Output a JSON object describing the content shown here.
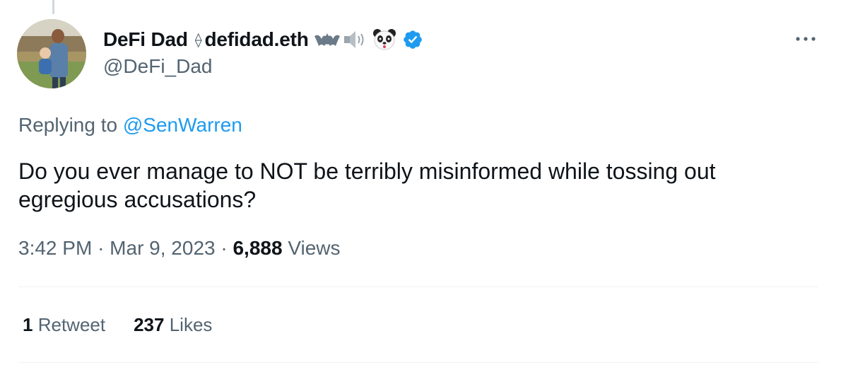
{
  "tweet": {
    "author": {
      "display_name": "DeFi Dad",
      "eth_symbol": "⟠",
      "ens_name": "defidad.eth",
      "emojis": [
        "bat-emoji",
        "speaker-emoji",
        "panda-emoji"
      ],
      "verified": true,
      "handle": "@DeFi_Dad",
      "avatar": "avatar-photo"
    },
    "replying_prefix": "Replying to",
    "replying_to": "@SenWarren",
    "text": "Do you ever manage to NOT be terribly misinformed while tossing out egregious accusations?",
    "time": "3:42 PM",
    "separator": "·",
    "date": "Mar 9, 2023",
    "views_count": "6,888",
    "views_label": "Views",
    "stats": {
      "retweets_count": "1",
      "retweets_label": "Retweet",
      "likes_count": "237",
      "likes_label": "Likes"
    },
    "more_icon": "more-options-icon"
  },
  "colors": {
    "text_primary": "#0f1419",
    "text_secondary": "#536471",
    "accent": "#1d9bf0",
    "divider": "#eff3f4"
  }
}
